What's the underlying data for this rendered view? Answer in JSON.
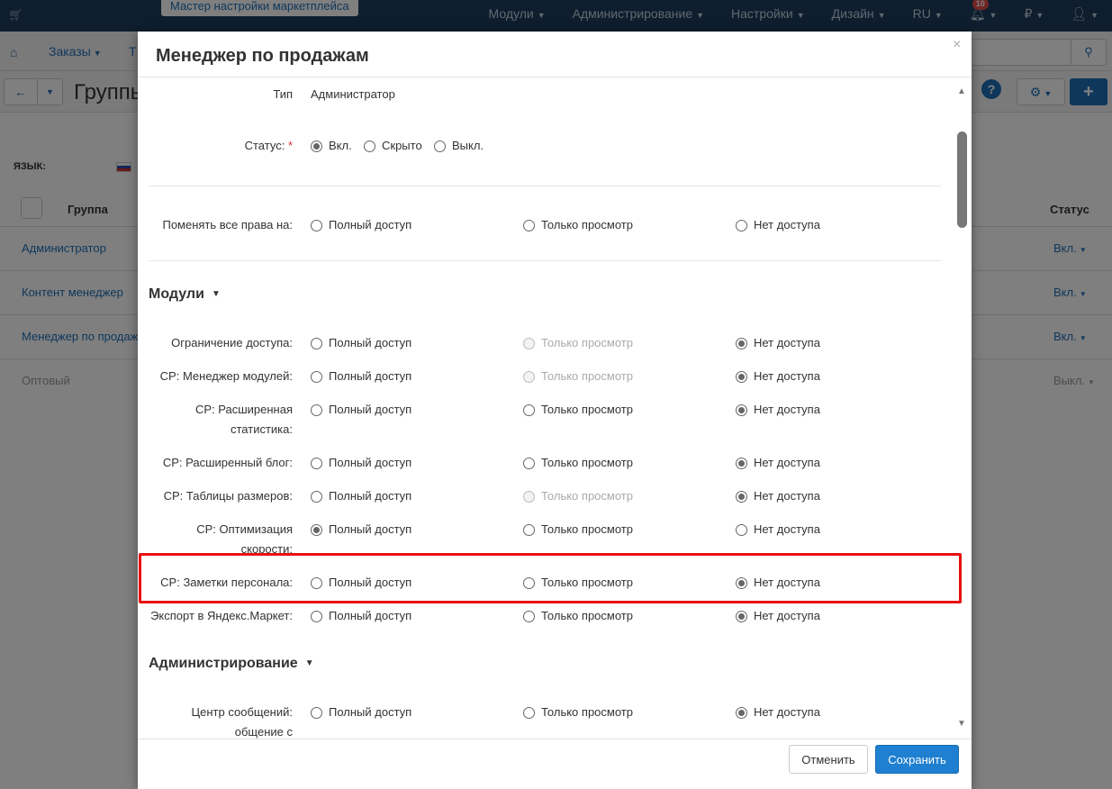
{
  "topbar": {
    "wizard_label": "Мастер настройки маркетплейса",
    "nav": [
      {
        "label": "Модули"
      },
      {
        "label": "Администрирование"
      },
      {
        "label": "Настройки"
      },
      {
        "label": "Дизайн"
      },
      {
        "label": "RU"
      }
    ],
    "notifications_count": "10",
    "currency": "₽"
  },
  "subbar": {
    "orders_label": "Заказы",
    "truncated_label": "Т"
  },
  "header": {
    "title": "Группы"
  },
  "background": {
    "lang_label": "ЯЗЫК:",
    "table": {
      "col_group": "Группа",
      "col_status": "Статус",
      "rows": [
        {
          "name": "Администратор",
          "status": "Вкл."
        },
        {
          "name": "Контент менеджер",
          "status": "Вкл."
        },
        {
          "name": "Менеджер по продажам",
          "status": "Вкл."
        },
        {
          "name": "Оптовый",
          "status": "Выкл."
        }
      ]
    }
  },
  "modal": {
    "title": "Менеджер по продажам",
    "type_label": "Тип",
    "type_value": "Администратор",
    "status_label": "Статус:",
    "required_mark": "*",
    "status_options": [
      "Вкл.",
      "Скрыто",
      "Выкл."
    ],
    "status_selected": "Вкл.",
    "change_all_label": "Поменять все права на:",
    "access_options": [
      "Полный доступ",
      "Только просмотр",
      "Нет доступа"
    ],
    "sections": [
      {
        "title": "Модули",
        "rows": [
          {
            "label": "Ограничение доступа:",
            "selected": 2,
            "view_disabled": true
          },
          {
            "label": "CP: Менеджер модулей:",
            "selected": 2,
            "view_disabled": true
          },
          {
            "label": "CP: Расширенная статистика:",
            "selected": 2,
            "view_disabled": false
          },
          {
            "label": "CP: Расширенный блог:",
            "selected": 2,
            "view_disabled": false
          },
          {
            "label": "CP: Таблицы размеров:",
            "selected": 2,
            "view_disabled": true
          },
          {
            "label": "CP: Оптимизация скорости:",
            "selected": 0,
            "view_disabled": false
          },
          {
            "label": "CP: Заметки персонала:",
            "selected": 2,
            "view_disabled": false
          },
          {
            "label": "Экспорт в Яндекс.Маркет:",
            "selected": 2,
            "view_disabled": false
          }
        ]
      },
      {
        "title": "Администрирование",
        "rows": [
          {
            "label": "Центр сообщений: общение с",
            "selected": 2,
            "view_disabled": false
          }
        ]
      }
    ],
    "cancel_label": "Отменить",
    "save_label": "Сохранить"
  }
}
